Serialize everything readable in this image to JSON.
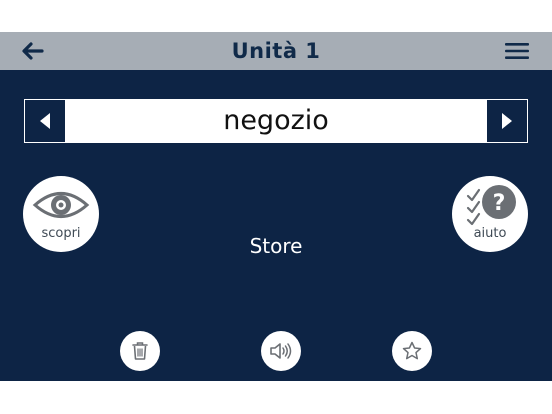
{
  "header": {
    "title": "Unità 1",
    "back_icon": "arrow-left-icon",
    "menu_icon": "hamburger-menu-icon"
  },
  "flashcard": {
    "word": "negozio",
    "translation": "Store",
    "prev_icon": "triangle-left-icon",
    "next_icon": "triangle-right-icon"
  },
  "actions": {
    "discover_label": "scopri",
    "discover_icon": "eye-icon",
    "help_label": "aiuto",
    "help_icon": "checklist-question-icon"
  },
  "toolbar": {
    "delete_icon": "trash-icon",
    "audio_icon": "speaker-icon",
    "favorite_icon": "star-icon"
  },
  "colors": {
    "background": "#0d2445",
    "header": "#a6adb5",
    "header_text": "#102a49",
    "button_bg": "#ffffff",
    "icon_gray": "#6b6f74"
  }
}
